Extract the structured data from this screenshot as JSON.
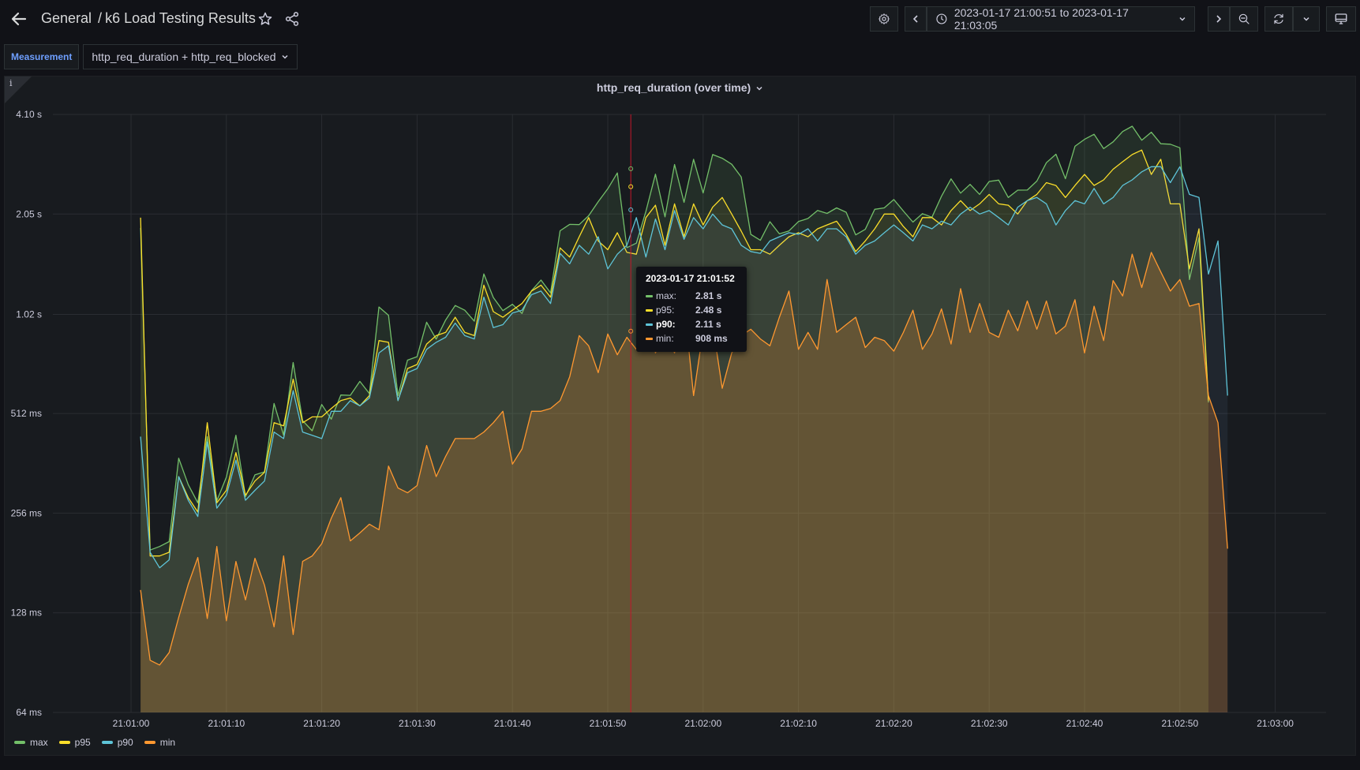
{
  "header": {
    "folder": "General",
    "separator": "/",
    "dashboard_title": "k6 Load Testing Results",
    "time_range": "2023-01-17 21:00:51 to 2023-01-17 21:03:05",
    "icons": [
      "back-arrow-icon",
      "star-icon",
      "share-icon",
      "gear-icon",
      "chevron-left-icon",
      "clock-icon",
      "chevron-down-icon",
      "chevron-right-icon",
      "zoom-out-icon",
      "refresh-icon",
      "chevron-down-icon",
      "tv-icon"
    ]
  },
  "variables": {
    "measurement_label": "Measurement",
    "measurement_value": "http_req_duration + http_req_blocked"
  },
  "panel": {
    "title": "http_req_duration (over time)",
    "info_glyph": "i"
  },
  "tooltip": {
    "time": "2023-01-17 21:01:52",
    "rows": [
      {
        "name": "max:",
        "value": "2.81 s"
      },
      {
        "name": "p95:",
        "value": "2.48 s"
      },
      {
        "name": "p90:",
        "value": "2.11 s"
      },
      {
        "name": "min:",
        "value": "908 ms"
      }
    ]
  },
  "colors": {
    "max": "#73bf69",
    "p95": "#fade2a",
    "p90": "#8ab8ff",
    "p90_line": "#5ec4d8",
    "min": "#ff9830",
    "cursor": "#c4162a"
  },
  "chart_data": {
    "type": "area",
    "x_start": "21:01:00",
    "x_step_seconds": 1,
    "x_first_offset_seconds": 1,
    "yscale": "log2",
    "ylim_ms": [
      64,
      4100
    ],
    "yticks": [
      {
        "ms": 64,
        "label": "64 ms"
      },
      {
        "ms": 128,
        "label": "128 ms"
      },
      {
        "ms": 256,
        "label": "256 ms"
      },
      {
        "ms": 512,
        "label": "512 ms"
      },
      {
        "ms": 1020,
        "label": "1.02 s"
      },
      {
        "ms": 2050,
        "label": "2.05 s"
      },
      {
        "ms": 4100,
        "label": "4.10 s"
      }
    ],
    "xticks": [
      "21:01:00",
      "21:01:10",
      "21:01:20",
      "21:01:30",
      "21:01:40",
      "21:01:50",
      "21:02:00",
      "21:02:10",
      "21:02:20",
      "21:02:30",
      "21:02:40",
      "21:02:50",
      "21:03:00"
    ],
    "grid": true,
    "legend_position": "bottom-left",
    "series": [
      {
        "name": "max",
        "values": [
          1862,
          198,
          203,
          210,
          375,
          312,
          275,
          436,
          279,
          329,
          440,
          287,
          334,
          341,
          549,
          440,
          730,
          487,
          454,
          545,
          492,
          582,
          581,
          640,
          588,
          1074,
          1014,
          580,
          742,
          760,
          966,
          859,
          981,
          1085,
          1050,
          973,
          1352,
          1147,
          1047,
          1094,
          1027,
          1203,
          1295,
          1185,
          1825,
          1908,
          1905,
          2027,
          2235,
          2444,
          2729,
          1623,
          1674,
          2089,
          2705,
          2010,
          2893,
          2224,
          3000,
          2374,
          3100,
          3022,
          2899,
          2652,
          1779,
          1708,
          1944,
          1786,
          1823,
          1946,
          1988,
          2101,
          2059,
          2140,
          2076,
          1774,
          1843,
          2119,
          2140,
          2268,
          2093,
          1938,
          2056,
          2005,
          2321,
          2618,
          2371,
          2520,
          2350,
          2572,
          2595,
          2301,
          2421,
          2422,
          2578,
          2931,
          3108,
          2621,
          3284,
          3447,
          3571,
          3231,
          3388,
          3640,
          3775,
          3427,
          3622,
          3342,
          3332,
          3250,
          1300,
          1742,
          553
        ]
      },
      {
        "name": "p95",
        "values": [
          1999,
          190,
          190,
          195,
          330,
          285,
          258,
          480,
          275,
          300,
          390,
          290,
          320,
          340,
          480,
          470,
          650,
          480,
          500,
          500,
          530,
          560,
          570,
          540,
          580,
          850,
          840,
          560,
          700,
          720,
          830,
          880,
          900,
          1000,
          900,
          880,
          1250,
          1040,
          1000,
          1050,
          1100,
          1200,
          1250,
          1150,
          1620,
          1520,
          1750,
          2000,
          1700,
          1600,
          1800,
          1570,
          1550,
          2000,
          2180,
          1650,
          2200,
          1750,
          2200,
          1900,
          2150,
          2300,
          2050,
          1820,
          1600,
          1600,
          1550,
          1650,
          1750,
          1800,
          1750,
          1850,
          1900,
          1950,
          1780,
          1580,
          1700,
          1850,
          2050,
          2050,
          1880,
          1750,
          2000,
          2000,
          1900,
          2100,
          2250,
          2100,
          2200,
          2350,
          2200,
          2180,
          2050,
          2250,
          2350,
          2550,
          2500,
          2300,
          2500,
          2700,
          2500,
          2600,
          2800,
          2950,
          3100,
          3200,
          2700,
          3000,
          2200,
          2200,
          1400,
          1850,
          560
        ]
      },
      {
        "name": "p90",
        "values": [
          436,
          195,
          175,
          185,
          330,
          280,
          250,
          420,
          265,
          290,
          370,
          280,
          300,
          320,
          450,
          430,
          600,
          450,
          440,
          430,
          520,
          520,
          560,
          540,
          570,
          780,
          820,
          560,
          680,
          700,
          800,
          840,
          870,
          960,
          880,
          860,
          1150,
          930,
          950,
          1030,
          1050,
          1170,
          1200,
          1100,
          1560,
          1450,
          1650,
          1550,
          1750,
          1400,
          1550,
          1650,
          2000,
          1520,
          1980,
          1600,
          2100,
          1720,
          2000,
          1850,
          2050,
          1900,
          1850,
          1650,
          1580,
          1560,
          1700,
          1750,
          1800,
          1780,
          1850,
          1700,
          1850,
          1850,
          1750,
          1550,
          1650,
          1700,
          1800,
          1900,
          1800,
          1700,
          1900,
          1850,
          1950,
          1900,
          2050,
          2150,
          2050,
          2100,
          2000,
          1900,
          2150,
          2250,
          2300,
          2200,
          1900,
          2100,
          2250,
          2200,
          2450,
          2200,
          2300,
          2500,
          2600,
          2750,
          2850,
          2850,
          2550,
          2850,
          2350,
          2300,
          1350,
          1700,
          580
        ]
      },
      {
        "name": "min",
        "values": [
          150,
          92,
          89,
          97,
          124,
          156,
          188,
          123,
          203,
          121,
          183,
          140,
          187,
          155,
          116,
          190,
          110,
          183,
          190,
          207,
          247,
          285,
          211,
          223,
          237,
          228,
          355,
          305,
          295,
          310,
          410,
          330,
          380,
          430,
          430,
          430,
          450,
          480,
          520,
          360,
          400,
          520,
          520,
          530,
          560,
          660,
          880,
          820,
          680,
          890,
          770,
          870,
          800,
          1070,
          780,
          908,
          780,
          1110,
          580,
          910,
          950,
          610,
          780,
          880,
          920,
          860,
          820,
          1000,
          1200,
          800,
          900,
          800,
          1300,
          900,
          950,
          1000,
          810,
          870,
          850,
          790,
          900,
          1050,
          800,
          890,
          1060,
          830,
          1220,
          900,
          1100,
          900,
          870,
          1050,
          910,
          1120,
          920,
          1120,
          890,
          940,
          1130,
          780,
          1080,
          850,
          1290,
          1160,
          1550,
          1230,
          1570,
          1370,
          1200,
          1300,
          1080,
          1100,
          580,
          480,
          200
        ]
      }
    ]
  }
}
